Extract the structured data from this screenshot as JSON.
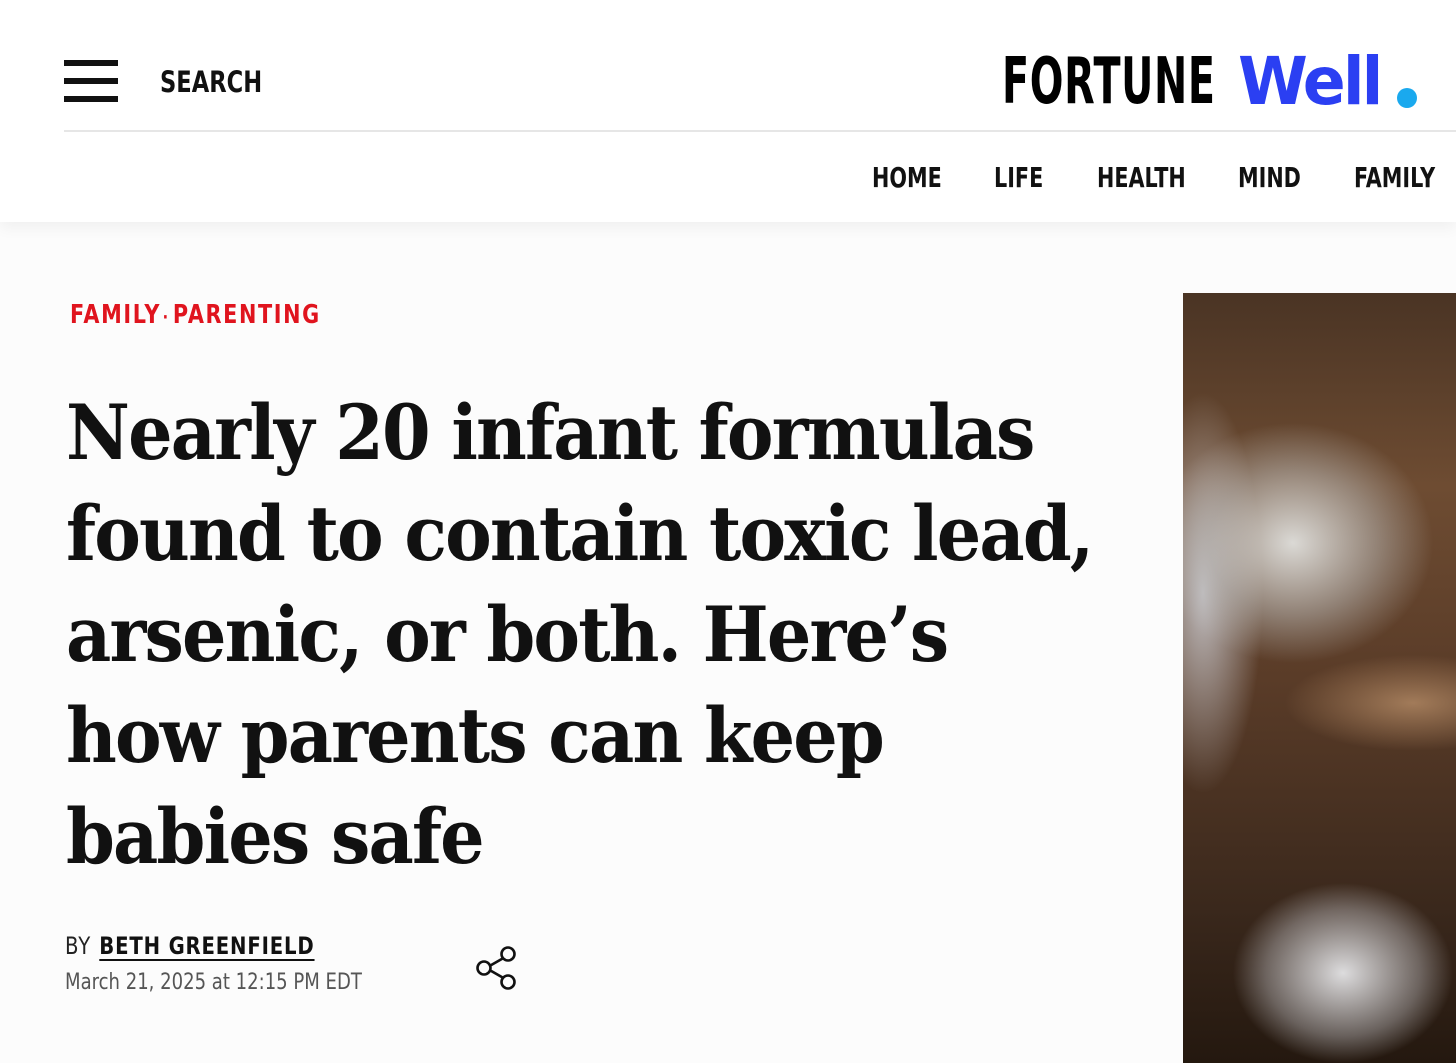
{
  "header": {
    "search_label": "SEARCH",
    "logo": {
      "primary": "FORTUNE",
      "secondary": "Well",
      "primary_color": "#000000",
      "secondary_color": "#2b3ff2",
      "dot_color": "#1aa9ee"
    }
  },
  "nav": {
    "items": [
      {
        "label": "HOME"
      },
      {
        "label": "LIFE"
      },
      {
        "label": "HEALTH"
      },
      {
        "label": "MIND"
      },
      {
        "label": "FAMILY"
      }
    ]
  },
  "article": {
    "kicker": {
      "section": "FAMILY",
      "separator": "·",
      "subsection": "PARENTING",
      "color": "#e0141e"
    },
    "headline_lines": [
      "Nearly 20 infant formulas",
      "found to contain toxic lead,",
      "arsenic, or both. Here’s",
      "how parents can keep",
      "babies safe"
    ],
    "byline": {
      "prefix": "BY",
      "author": "BETH GREENFIELD"
    },
    "date": "March 21, 2025 at 12:15 PM EDT"
  },
  "icons": {
    "menu": "hamburger-menu-icon",
    "share": "share-icon"
  }
}
